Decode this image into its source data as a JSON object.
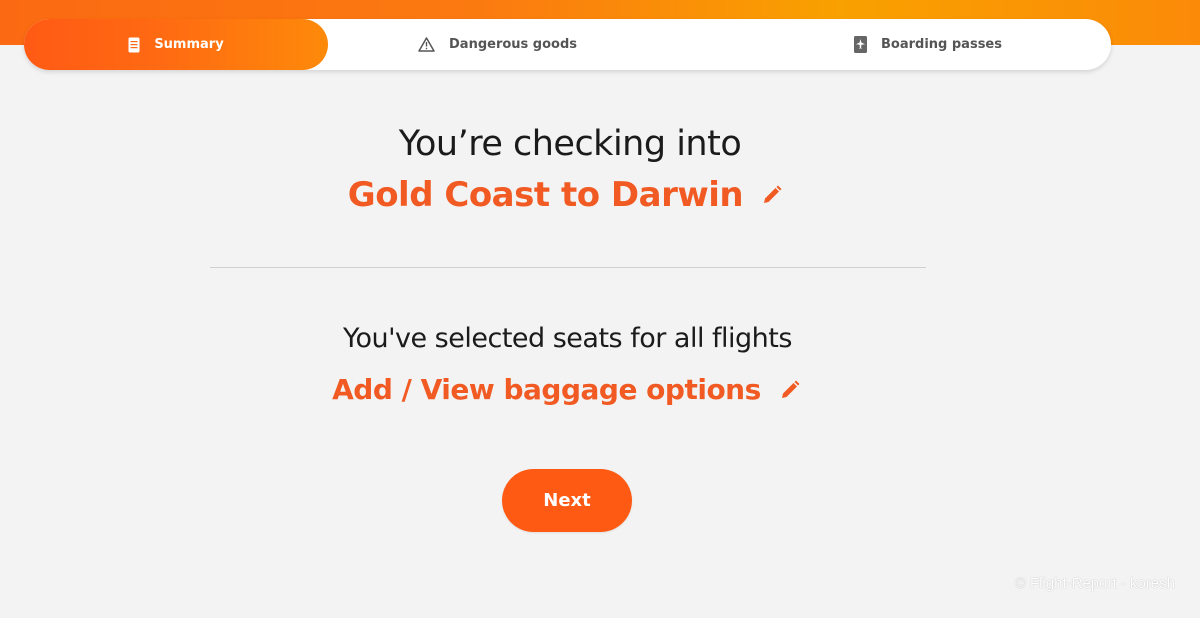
{
  "colors": {
    "accent": "#f15a22",
    "button": "#ff5a14",
    "header_gradient_start": "#fb6a12",
    "header_gradient_end": "#f9a100",
    "background": "#f3f3f3"
  },
  "steps": [
    {
      "label": "Summary",
      "icon": "document-icon",
      "active": true
    },
    {
      "label": "Dangerous goods",
      "icon": "warning-triangle-icon",
      "active": false
    },
    {
      "label": "Boarding passes",
      "icon": "boarding-pass-icon",
      "active": false
    }
  ],
  "main": {
    "heading": "You’re checking into",
    "route": "Gold Coast to Darwin",
    "seats_status": "You've selected seats for all flights",
    "baggage_link": "Add / View baggage options",
    "next_button": "Next",
    "edit_icon": "pencil-icon"
  },
  "watermark": "© Flight-Report - koresh"
}
